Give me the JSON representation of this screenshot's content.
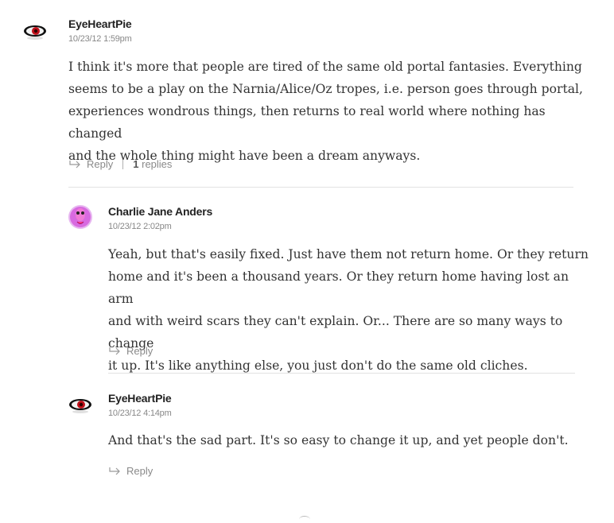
{
  "comments": [
    {
      "username": "EyeHeartPie",
      "timestamp": "10/23/12 1:59pm",
      "avatar_icon": "red-eye-icon",
      "body_lines": [
        "I think it's more that people are tired of the same old portal fantasies. Everything",
        "seems to be a play on the Narnia/Alice/Oz tropes, i.e. person goes through portal,",
        "experiences wondrous things, then returns to real world where nothing has changed",
        "and the whole thing might have been a dream anyways."
      ],
      "reply_label": "Reply",
      "replies_count": "1",
      "replies_label": "replies"
    },
    {
      "username": "Charlie Jane Anders",
      "timestamp": "10/23/12 2:02pm",
      "avatar_icon": "pink-figure-icon",
      "body_lines": [
        "Yeah, but that's easily fixed. Just have them not return home. Or they return",
        "home and it's been a thousand years. Or they return home having lost an arm",
        "and with weird scars they can't explain. Or... There are so many ways to change",
        "it up. It's like anything else, you just don't do the same old cliches."
      ],
      "reply_label": "Reply"
    },
    {
      "username": "EyeHeartPie",
      "timestamp": "10/23/12 4:14pm",
      "avatar_icon": "red-eye-icon",
      "body_lines": [
        "And that's the sad part. It's so easy to change it up, and yet people don't."
      ],
      "reply_label": "Reply"
    }
  ],
  "colors": {
    "username": "#222222",
    "timestamp": "#888888",
    "body": "#333333",
    "action": "#8a8a8a",
    "divider": "#e2e2e2"
  }
}
